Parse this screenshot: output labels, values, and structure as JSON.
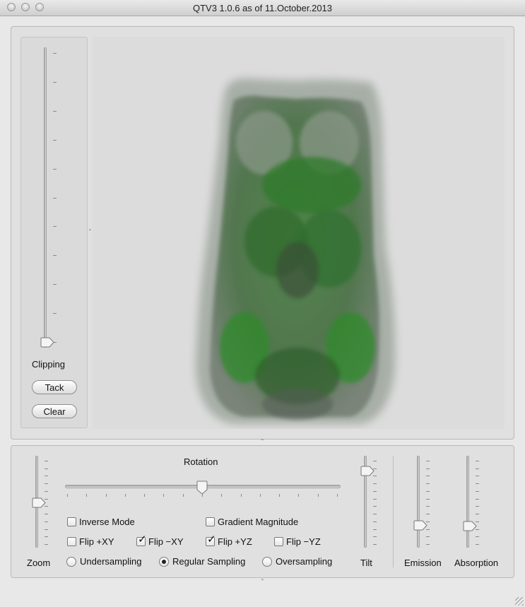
{
  "window": {
    "title": "QTV3 1.0.6 as of 11.October.2013"
  },
  "clipping": {
    "label": "Clipping",
    "tack_label": "Tack",
    "clear_label": "Clear",
    "value_fraction": 0.0
  },
  "rotation": {
    "label": "Rotation",
    "value_fraction": 0.5
  },
  "zoom": {
    "label": "Zoom",
    "value_fraction": 0.5
  },
  "tilt": {
    "label": "Tilt",
    "value_fraction": 1.0
  },
  "emission": {
    "label": "Emission",
    "value_fraction": 0.23
  },
  "absorption": {
    "label": "Absorption",
    "value_fraction": 0.22
  },
  "options": {
    "inverse_mode": {
      "label": "Inverse Mode",
      "checked": false
    },
    "gradient_magnitude": {
      "label": "Gradient Magnitude",
      "checked": false
    },
    "flip_pxy": {
      "label": "Flip +XY",
      "checked": false
    },
    "flip_mxy": {
      "label": "Flip −XY",
      "checked": true
    },
    "flip_pyz": {
      "label": "Flip +YZ",
      "checked": true
    },
    "flip_myz": {
      "label": "Flip −YZ",
      "checked": false
    }
  },
  "sampling": {
    "under": {
      "label": "Undersampling",
      "selected": false
    },
    "regular": {
      "label": "Regular Sampling",
      "selected": true
    },
    "over": {
      "label": "Oversampling",
      "selected": false
    }
  },
  "colors": {
    "volume_tint": "#2e8a2a",
    "background": "#dcdcdc"
  }
}
